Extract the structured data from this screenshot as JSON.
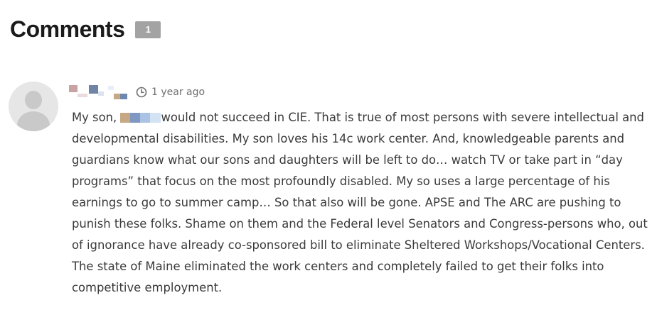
{
  "comments_section": {
    "title": "Comments",
    "count": "1"
  },
  "comment": {
    "author_display": "redacted",
    "timestamp": "1 year ago",
    "text_before_name": "My son, ",
    "text_after_name": "would not succeed in CIE. That is true of most persons with severe intellectual and developmental disabilities. My son loves his 14c work center. And, knowledgeable parents and guardians know what our sons and daughters will be left to do… watch TV or take part in “day programs” that focus on the most profoundly disabled. My so uses a large percentage of his earnings to go to summer camp… So that also will be gone. APSE and The ARC are pushing to punish these folks. Shame on them and the Federal level Senators and Congress-persons who, out of ignorance have already co-sponsored bill to eliminate Sheltered Workshops/Vocational Centers. The state of Maine eliminated the work centers and completely failed to get their folks into competitive employment."
  },
  "icons": {
    "avatar": "default-user-avatar",
    "time": "clock-icon"
  },
  "colors": {
    "badge_bg": "#a3a3a3",
    "body_text": "#3a3a3a",
    "meta_text": "#6f6f6f"
  }
}
